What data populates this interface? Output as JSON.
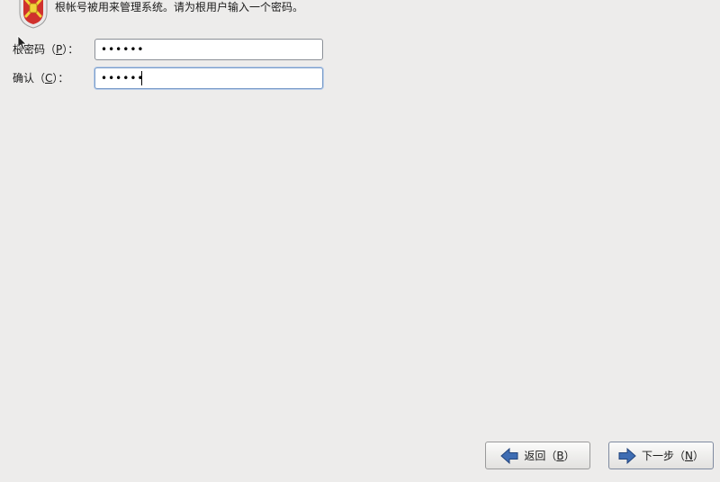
{
  "header": {
    "icon": "shield-icon",
    "intro_text": "根帐号被用来管理系统。请为根用户输入一个密码。"
  },
  "form": {
    "password": {
      "label_prefix": "根密码（",
      "mnemonic": "P",
      "label_suffix": "）：",
      "value": "••••••"
    },
    "confirm": {
      "label_prefix": "确认（",
      "mnemonic": "C",
      "label_suffix": "）：",
      "value": "••••••"
    }
  },
  "buttons": {
    "back": {
      "icon": "arrow-left-icon",
      "label_prefix": "返回（",
      "mnemonic": "B",
      "label_suffix": "）"
    },
    "next": {
      "icon": "arrow-right-icon",
      "label_prefix": "下一步（",
      "mnemonic": "N",
      "label_suffix": "）"
    }
  },
  "colors": {
    "background": "#edeceb",
    "arrow_blue": "#3f6db3",
    "shield_red": "#d0312d"
  }
}
